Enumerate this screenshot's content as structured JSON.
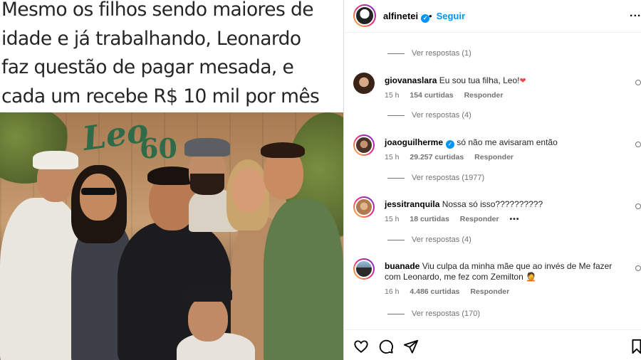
{
  "post": {
    "caption": "Mesmo os filhos sendo maiores de\nidade e já trabalhando, Leonardo\nfaz questão de pagar mesada, e\ncada um recebe R$ 10 mil por mês",
    "sign_text": "Leo",
    "sign_number": "60"
  },
  "header": {
    "username": "alfinetei",
    "separator": "•",
    "follow_label": "Seguir",
    "more_label": "..."
  },
  "verified_mark": "✓",
  "comments": [
    {
      "replies_before": "Ver respostas (1)"
    },
    {
      "username": "giovanaslara",
      "text": "Eu sou tua filha, Leo!",
      "emoji": "❤",
      "time": "15 h",
      "likes": "154 curtidas",
      "reply_label": "Responder",
      "replies": "Ver respostas (4)"
    },
    {
      "username": "joaoguilherme",
      "verified": true,
      "text": "só não me avisaram então",
      "time": "15 h",
      "likes": "29.257 curtidas",
      "reply_label": "Responder",
      "replies": "Ver respostas (1977)"
    },
    {
      "username": "jessitranquila",
      "text": "Nossa só isso??????????",
      "time": "15 h",
      "likes": "18 curtidas",
      "reply_label": "Responder",
      "more": "•••",
      "replies": "Ver respostas (4)"
    },
    {
      "username": "buanade",
      "text": "Viu culpa da minha mãe que ao invés de Me fazer com Leonardo, me fez com Zemilton",
      "emoji": "🤦",
      "time": "16 h",
      "likes": "4.486 curtidas",
      "reply_label": "Responder",
      "replies": "Ver respostas (170)"
    }
  ],
  "actions": {
    "icons": [
      "heart-icon",
      "comment-icon",
      "share-icon",
      "bookmark-icon"
    ]
  },
  "colors": {
    "link_blue": "#0095f6",
    "muted_gray": "#737373",
    "heart_red": "#ed4956"
  }
}
